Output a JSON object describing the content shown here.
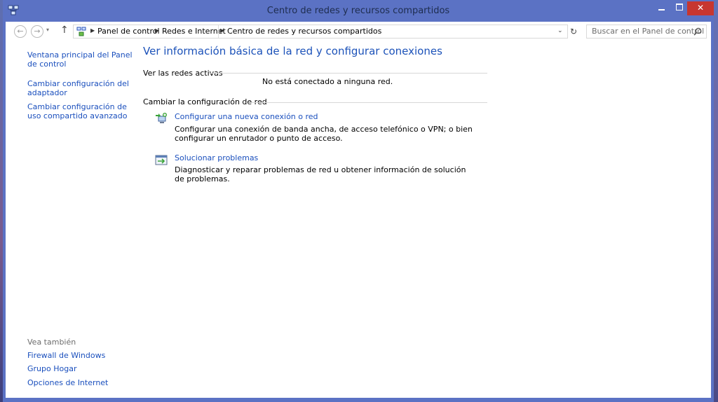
{
  "window": {
    "title": "Centro de redes y recursos compartidos",
    "accent_color": "#5b72c4",
    "close_color": "#c7362f",
    "close_glyph": "✕"
  },
  "nav": {
    "back_glyph": "←",
    "forward_glyph": "→",
    "dropdown_glyph": "▾",
    "up_glyph": "↑"
  },
  "address": {
    "separator": "▶",
    "crumbs": [
      "Panel de control",
      "Redes e Internet",
      "Centro de redes y recursos compartidos"
    ],
    "dropdown_glyph": "⌄",
    "refresh_glyph": "↻"
  },
  "search": {
    "placeholder": "Buscar en el Panel de control"
  },
  "sidebar": {
    "links": [
      "Ventana principal del Panel de control",
      "Cambiar configuración del adaptador",
      "Cambiar configuración de uso compartido avanzado"
    ],
    "see_also_label": "Vea también",
    "see_also": [
      "Firewall de Windows",
      "Grupo Hogar",
      "Opciones de Internet"
    ]
  },
  "main": {
    "title": "Ver información básica de la red y configurar conexiones",
    "active_networks_label": "Ver las redes activas",
    "no_network_text": "No está conectado a ninguna red.",
    "change_settings_label": "Cambiar la configuración de red",
    "tasks": [
      {
        "link": "Configurar una nueva conexión o red",
        "description": "Configurar una conexión de banda ancha, de acceso telefónico o VPN; o bien configurar un enrutador o punto de acceso.",
        "icon": "new-connection-icon"
      },
      {
        "link": "Solucionar problemas",
        "description": "Diagnosticar y reparar problemas de red u obtener información de solución de problemas.",
        "icon": "troubleshoot-icon"
      }
    ]
  }
}
